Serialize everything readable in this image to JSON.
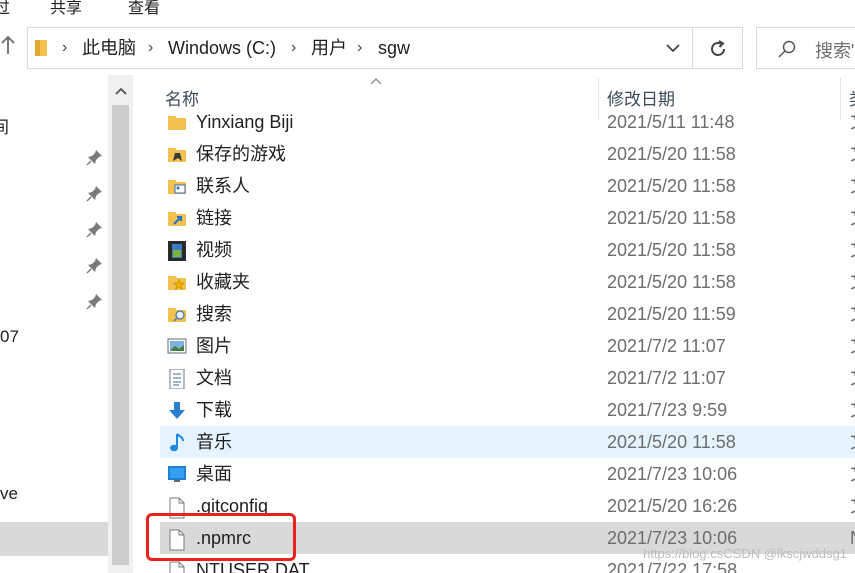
{
  "ribbon": {
    "tabs": [
      "共享",
      "查看"
    ]
  },
  "address": {
    "breadcrumbs": [
      "此电脑",
      "Windows (C:)",
      "用户",
      "sgw"
    ],
    "search_placeholder": "搜索\""
  },
  "nav": {
    "partial_labels": [
      "间",
      "07",
      "ve"
    ],
    "pinned_count": 5
  },
  "columns": {
    "name": "名称",
    "date": "修改日期",
    "type": "类"
  },
  "rows": [
    {
      "name": "Yinxiang Biji",
      "date": "2021/5/11 11:48",
      "type": "文",
      "icon": "folder-icon"
    },
    {
      "name": "保存的游戏",
      "date": "2021/5/20 11:58",
      "type": "文",
      "icon": "saved-games-folder-icon"
    },
    {
      "name": "联系人",
      "date": "2021/5/20 11:58",
      "type": "文",
      "icon": "contacts-folder-icon"
    },
    {
      "name": "链接",
      "date": "2021/5/20 11:58",
      "type": "文",
      "icon": "links-folder-icon"
    },
    {
      "name": "视频",
      "date": "2021/5/20 11:58",
      "type": "文",
      "icon": "videos-folder-icon"
    },
    {
      "name": "收藏夹",
      "date": "2021/5/20 11:58",
      "type": "文",
      "icon": "favorites-folder-icon"
    },
    {
      "name": "搜索",
      "date": "2021/5/20 11:59",
      "type": "文",
      "icon": "searches-folder-icon"
    },
    {
      "name": "图片",
      "date": "2021/7/2 11:07",
      "type": "文",
      "icon": "pictures-folder-icon"
    },
    {
      "name": "文档",
      "date": "2021/7/2 11:07",
      "type": "文",
      "icon": "documents-folder-icon"
    },
    {
      "name": "下载",
      "date": "2021/7/23 9:59",
      "type": "文",
      "icon": "downloads-folder-icon"
    },
    {
      "name": "音乐",
      "date": "2021/5/20 11:58",
      "type": "文",
      "icon": "music-folder-icon"
    },
    {
      "name": "桌面",
      "date": "2021/7/23 10:06",
      "type": "文",
      "icon": "desktop-folder-icon"
    },
    {
      "name": ".gitconfig",
      "date": "2021/5/20 16:26",
      "type": "文",
      "icon": "file-icon"
    },
    {
      "name": ".npmrc",
      "date": "2021/7/23 10:06",
      "type": "N",
      "icon": "file-icon"
    },
    {
      "name": "NTUSER.DAT",
      "date": "2021/7/22 17:58",
      "type": "",
      "icon": "file-icon"
    }
  ],
  "watermark": "https://blog.csCSDN @lkscjwddsg1",
  "colors": {
    "hover_row": "#e5f3ff",
    "selected_row": "#d9d9d9",
    "highlight_box": "#e8231d"
  }
}
